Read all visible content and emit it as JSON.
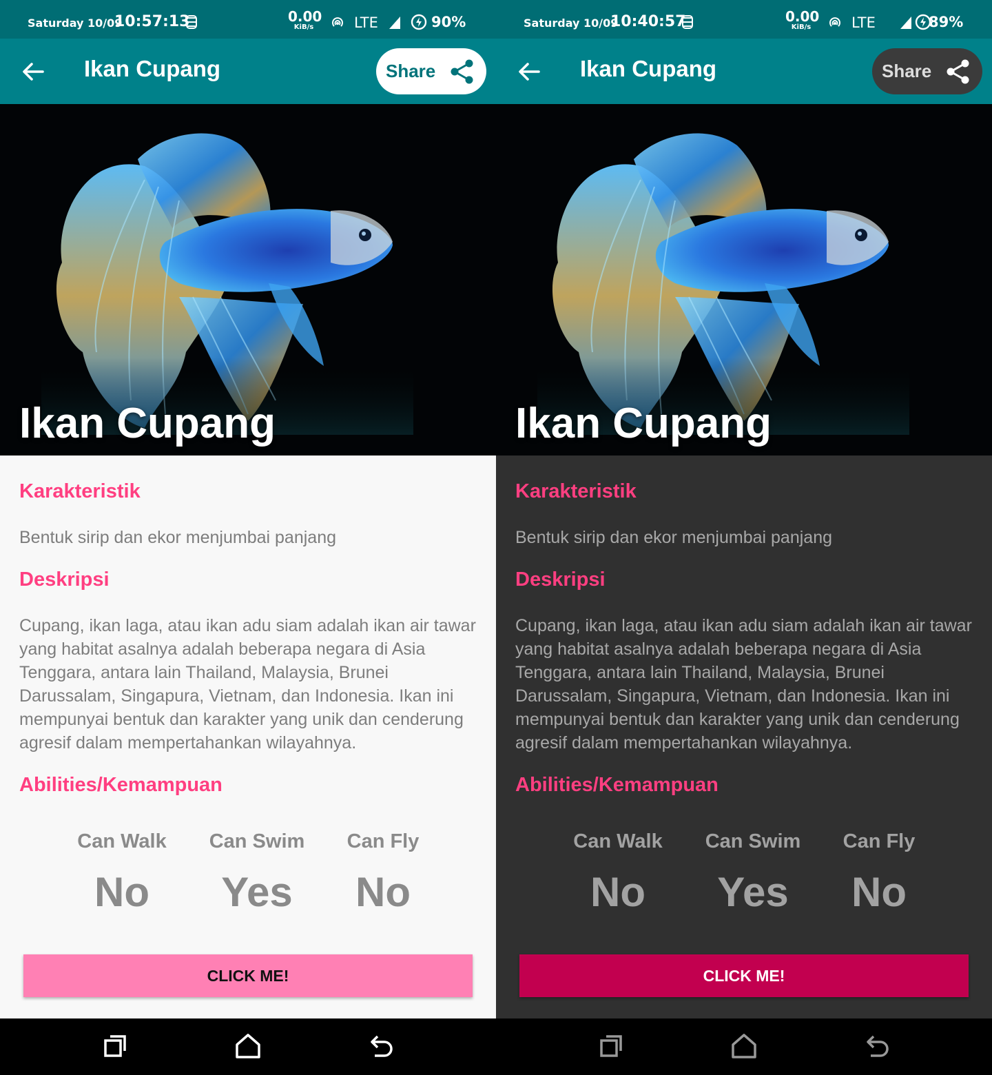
{
  "screens": [
    {
      "theme": "light",
      "status": {
        "day": "Saturday 10/09",
        "time": "10:57:13",
        "net_value": "0.00",
        "net_unit": "KiB/s",
        "network": "LTE",
        "battery": "90%"
      },
      "appbar": {
        "title": "Ikan Cupang",
        "share_label": "Share"
      },
      "hero": {
        "title": "Ikan Cupang"
      },
      "sections": {
        "karakteristik_title": "Karakteristik",
        "karakteristik_text": "Bentuk sirip dan ekor menjumbai panjang",
        "deskripsi_title": "Deskripsi",
        "deskripsi_text": "Cupang, ikan laga, atau ikan adu siam adalah ikan air tawar yang habitat asalnya adalah beberapa negara di Asia Tenggara, antara lain Thailand, Malaysia, Brunei Darussalam, Singapura, Vietnam, dan Indonesia. Ikan ini mempunyai bentuk dan karakter yang unik dan cenderung agresif dalam mempertahankan wilayahnya.",
        "abilities_title": "Abilities/Kemampuan"
      },
      "abilities": [
        {
          "label": "Can Walk",
          "value": "No"
        },
        {
          "label": "Can Swim",
          "value": "Yes"
        },
        {
          "label": "Can Fly",
          "value": "No"
        }
      ],
      "button_label": "CLICK ME!"
    },
    {
      "theme": "dark",
      "status": {
        "day": "Saturday 10/09",
        "time": "10:40:57",
        "net_value": "0.00",
        "net_unit": "KiB/s",
        "network": "LTE",
        "battery": "89%"
      },
      "appbar": {
        "title": "Ikan Cupang",
        "share_label": "Share"
      },
      "hero": {
        "title": "Ikan Cupang"
      },
      "sections": {
        "karakteristik_title": "Karakteristik",
        "karakteristik_text": "Bentuk sirip dan ekor menjumbai panjang",
        "deskripsi_title": "Deskripsi",
        "deskripsi_text": "Cupang, ikan laga, atau ikan adu siam adalah ikan air tawar yang habitat asalnya adalah beberapa negara di Asia Tenggara, antara lain Thailand, Malaysia, Brunei Darussalam, Singapura, Vietnam, dan Indonesia. Ikan ini mempunyai bentuk dan karakter yang unik dan cenderung agresif dalam mempertahankan wilayahnya.",
        "abilities_title": "Abilities/Kemampuan"
      },
      "abilities": [
        {
          "label": "Can Walk",
          "value": "No"
        },
        {
          "label": "Can Swim",
          "value": "Yes"
        },
        {
          "label": "Can Fly",
          "value": "No"
        }
      ],
      "button_label": "CLICK ME!"
    }
  ],
  "colors": {
    "status_bar": "#006d74",
    "app_bar": "#00818a",
    "section_title": "#ff3f81",
    "button_light": "#ff80b4",
    "button_dark": "#c2004f",
    "content_light": "#f8f8f8",
    "content_dark": "#303030"
  },
  "icons": [
    "back-arrow-icon",
    "share-icon",
    "data-saver-icon",
    "hotspot-icon",
    "signal-icon",
    "battery-saver-icon",
    "recents-icon",
    "home-icon",
    "back-nav-icon"
  ]
}
